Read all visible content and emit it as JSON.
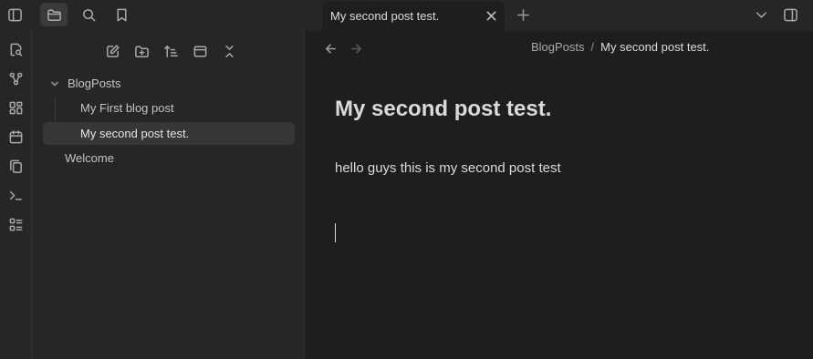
{
  "window": {
    "active_tab_title": "My second post test."
  },
  "top_bar": {
    "icons": [
      "sidebar-toggle-icon",
      "folder-icon",
      "search-icon",
      "bookmark-icon",
      "close-icon",
      "plus-icon",
      "chevron-down-icon",
      "right-sidebar-toggle-icon"
    ],
    "active_view": "files"
  },
  "ribbon": {
    "icons": [
      "open-quick-switcher-icon",
      "graph-view-icon",
      "canvas-icon",
      "daily-note-icon",
      "templates-icon",
      "command-palette-icon",
      "bases-icon"
    ]
  },
  "explorer": {
    "actions": [
      "new-note-icon",
      "new-folder-icon",
      "sort-icon",
      "auto-reveal-icon",
      "collapse-all-icon"
    ],
    "tree": {
      "folder": "BlogPosts",
      "children": [
        "My First blog post",
        "My second post test."
      ],
      "root_files": [
        "Welcome"
      ],
      "selected": "My second post test."
    }
  },
  "editor": {
    "breadcrumb": {
      "parent": "BlogPosts",
      "separator": "/",
      "current": "My second post test."
    },
    "title": "My second post test.",
    "body": "hello guys this is my second post test"
  },
  "colors": {
    "background": "#1e1e1e",
    "panel": "#262626",
    "selected": "#363636",
    "text": "#dadada"
  }
}
